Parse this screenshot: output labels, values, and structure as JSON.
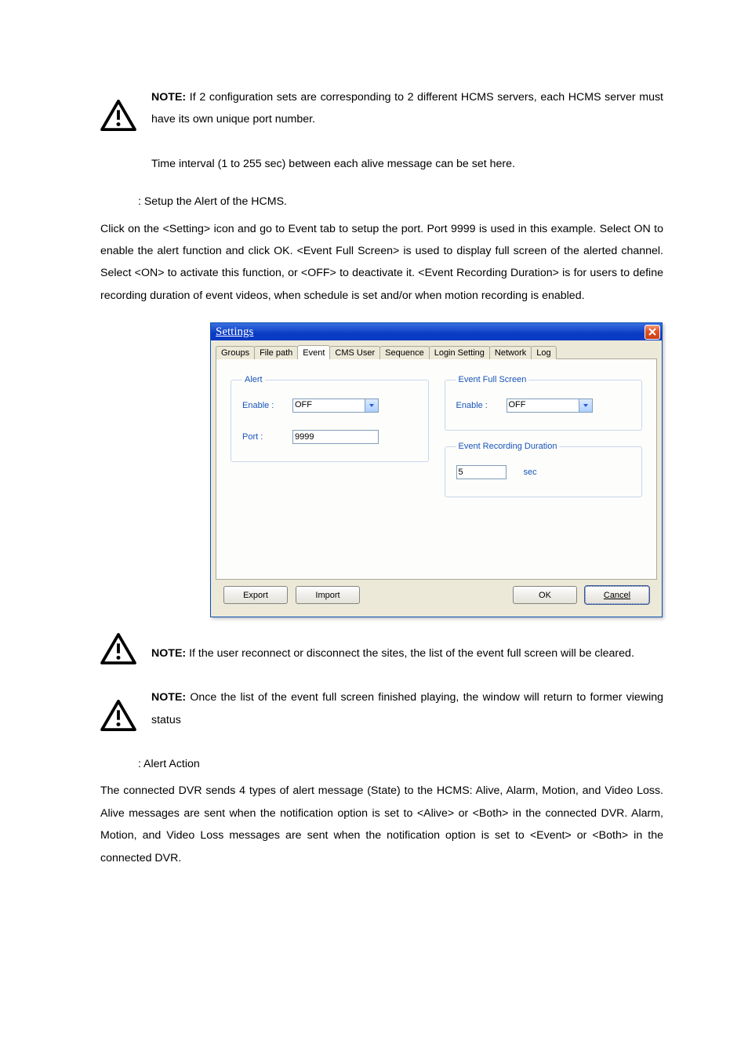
{
  "notes": {
    "note1_label": "NOTE:",
    "note1_text": " If 2 configuration sets are corresponding to 2 different HCMS servers, each HCMS server must have its own unique port number.",
    "interval_text": "Time interval (1 to 255 sec) between each alive message can be set here.",
    "alert_head": " : Setup the Alert of the HCMS.",
    "alert_para": "Click on the <Setting> icon and go to Event tab to setup the port. Port 9999 is used in this example. Select ON to enable the alert function and click OK. <Event Full Screen> is used to display full screen of the alerted channel. Select <ON> to activate this function, or <OFF> to deactivate it. <Event Recording Duration> is for users to define recording duration of event videos, when schedule is set and/or when motion recording is enabled.",
    "note2_label": "NOTE:",
    "note2_text": " If the user reconnect or disconnect the sites, the list of the event full screen will be cleared.",
    "note3_label": "NOTE:",
    "note3_text": " Once the list of the event full screen finished playing, the window will return to former viewing status",
    "action_head": " : Alert Action",
    "action_para": "The connected DVR sends 4 types of alert message (State) to the HCMS: Alive, Alarm, Motion, and Video Loss. Alive messages are sent when the notification option is set to <Alive> or <Both> in the connected DVR. Alarm, Motion, and Video Loss messages are sent when the notification option is set to <Event> or <Both> in the connected DVR."
  },
  "dialog": {
    "title": "Settings",
    "tabs": [
      "Groups",
      "File path",
      "Event",
      "CMS User",
      "Sequence",
      "Login Setting",
      "Network",
      "Log"
    ],
    "selected_tab_index": 2,
    "alert_group": {
      "legend": "Alert",
      "enable_label": "Enable :",
      "enable_value": "OFF",
      "port_label": "Port :",
      "port_value": "9999"
    },
    "efs_group": {
      "legend": "Event Full Screen",
      "enable_label": "Enable  :",
      "enable_value": "OFF"
    },
    "erd_group": {
      "legend": "Event Recording Duration",
      "value": "5",
      "unit": "sec"
    },
    "buttons": {
      "export": "Export",
      "import": "Import",
      "ok": "OK",
      "cancel": "Cancel"
    }
  }
}
